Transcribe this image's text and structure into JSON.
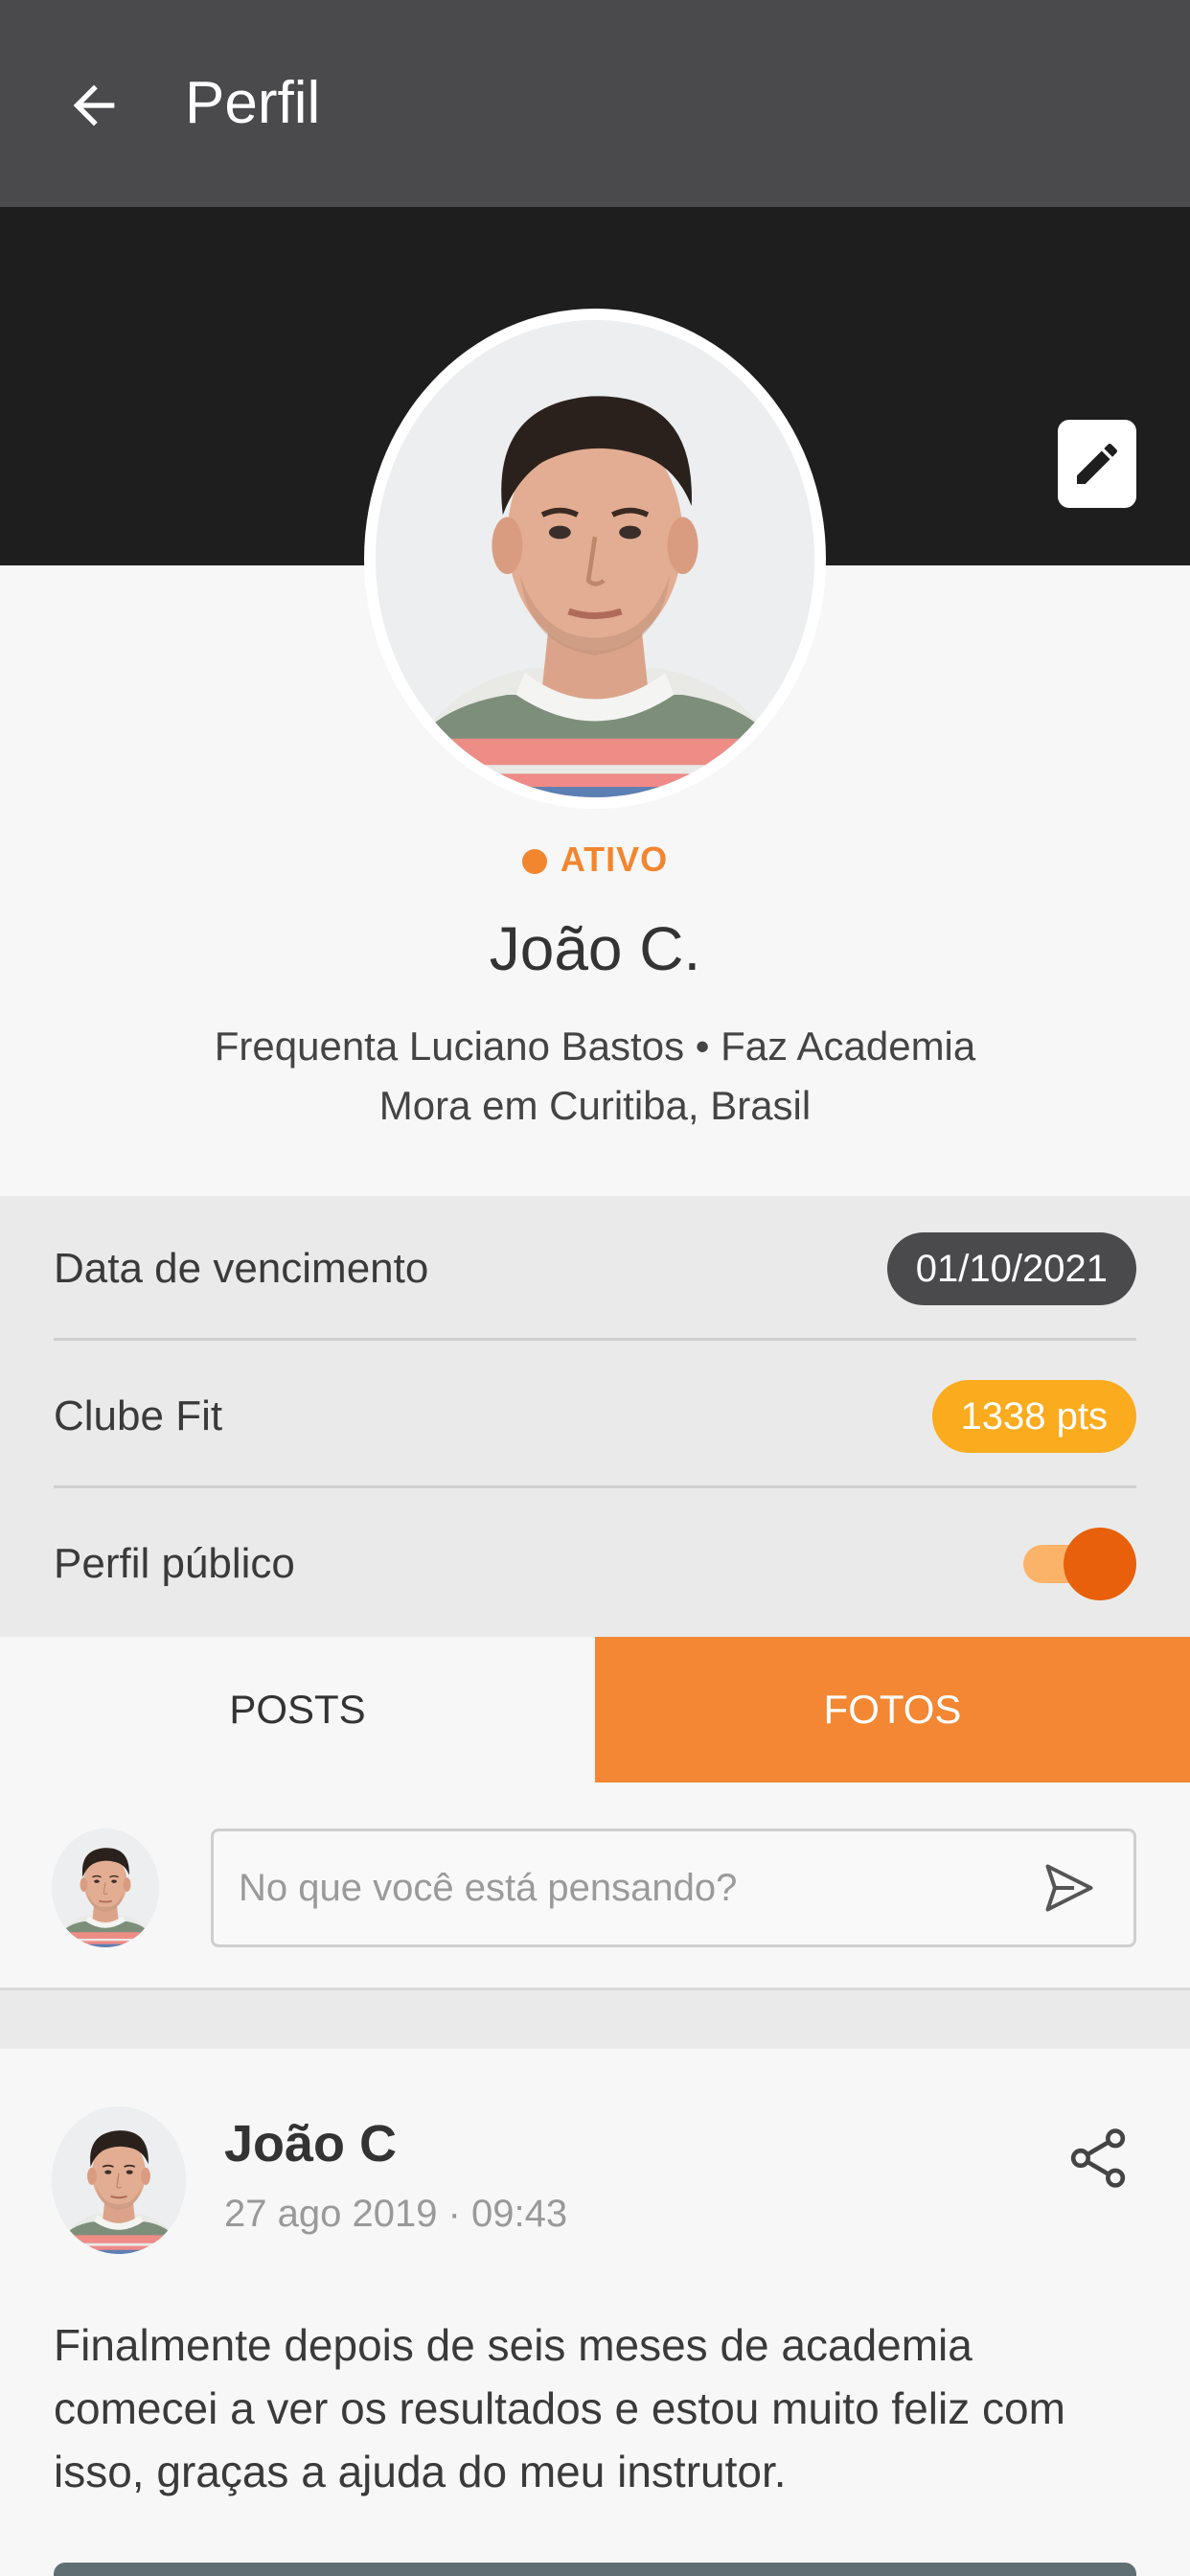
{
  "appbar": {
    "title": "Perfil",
    "back_icon": "arrow-left-icon"
  },
  "profile": {
    "status": "ATIVO",
    "name": "João C.",
    "line1": "Frequenta Luciano Bastos • Faz Academia",
    "line2": "Mora em Curitiba, Brasil",
    "edit_icon": "pencil-icon"
  },
  "info": {
    "expiry_label": "Data de vencimento",
    "expiry_value": "01/10/2021",
    "club_label": "Clube Fit",
    "club_value": "1338 pts",
    "public_label": "Perfil público",
    "public_enabled": true
  },
  "tabs": {
    "posts": "POSTS",
    "fotos": "FOTOS",
    "active": "fotos"
  },
  "composer": {
    "placeholder": "No que você está pensando?",
    "value": "",
    "send_icon": "send-icon"
  },
  "post": {
    "author": "João C",
    "date": "27 ago 2019 · 09:43",
    "text": "Finalmente depois de seis meses de academia comecei a ver os resultados e estou muito feliz com isso, graças a ajuda do meu instrutor.",
    "share_icon": "share-icon"
  },
  "colors": {
    "appbar": "#4a4a4c",
    "cover": "#1e1e1e",
    "accent": "#f38733",
    "points": "#fbab1e",
    "toggle_on": "#e8600b"
  }
}
